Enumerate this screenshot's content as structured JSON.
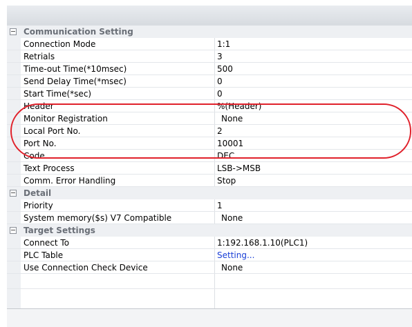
{
  "categories": {
    "communication": "Communication Setting",
    "detail": "Detail",
    "target": "Target Settings"
  },
  "communication": [
    {
      "name": "Connection Mode",
      "value": "1:1"
    },
    {
      "name": "Retrials",
      "value": "3"
    },
    {
      "name": "Time-out Time(*10msec)",
      "value": "500"
    },
    {
      "name": "Send Delay Time(*msec)",
      "value": "0"
    },
    {
      "name": "Start Time(*sec)",
      "value": "0"
    },
    {
      "name": "Header",
      "value": "%(Header)"
    },
    {
      "name": "Monitor Registration",
      "value": "None"
    },
    {
      "name": "Local Port No.",
      "value": "2"
    },
    {
      "name": "Port No.",
      "value": "10001"
    },
    {
      "name": "Code",
      "value": "DEC"
    },
    {
      "name": "Text Process",
      "value": "LSB->MSB"
    },
    {
      "name": "Comm. Error Handling",
      "value": "Stop"
    }
  ],
  "detail": [
    {
      "name": "Priority",
      "value": "1"
    },
    {
      "name": "System memory($s) V7 Compatible",
      "value": "None"
    }
  ],
  "target": [
    {
      "name": "Connect To",
      "value": "1:192.168.1.10(PLC1)"
    },
    {
      "name": "PLC Table",
      "value": "Setting..."
    },
    {
      "name": "Use Connection Check Device",
      "value": "None"
    }
  ],
  "colors": {
    "highlight": "#e0202a",
    "link": "#1a3fd6"
  }
}
